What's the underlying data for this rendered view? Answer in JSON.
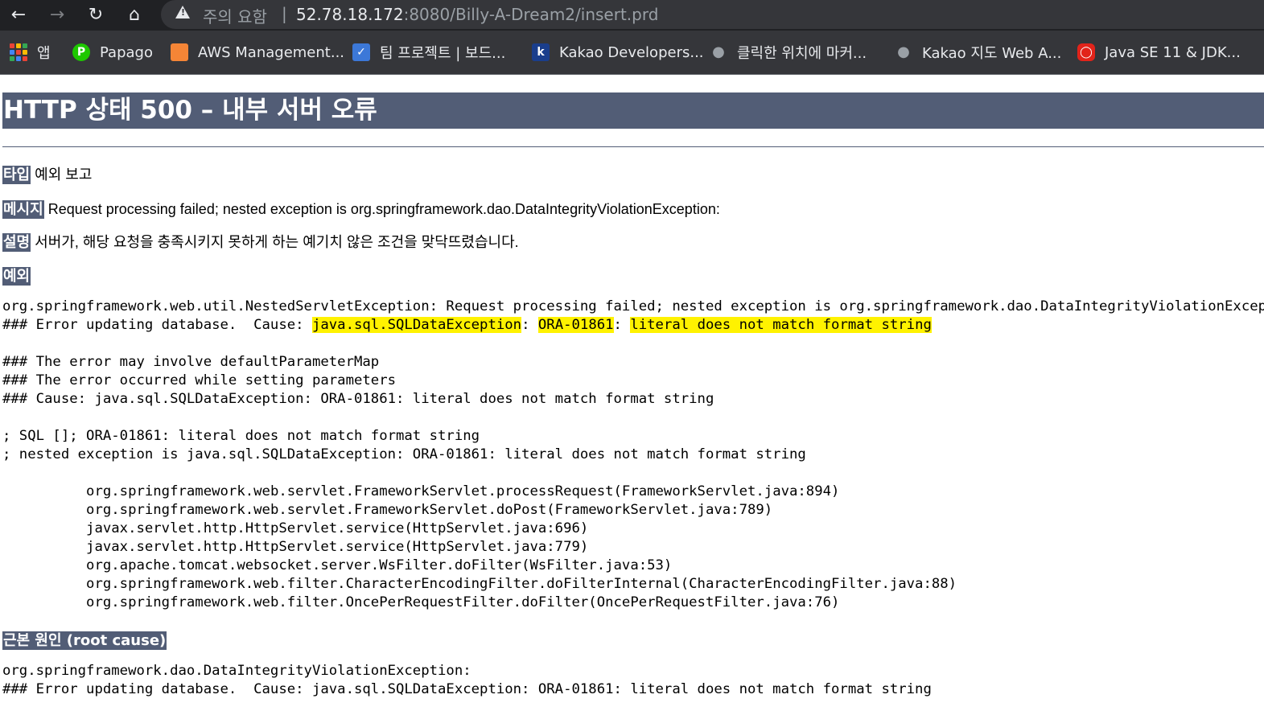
{
  "browser": {
    "security_label": "주의 요함",
    "separator": "|",
    "url_host": "52.78.18.172",
    "url_rest": ":8080/Billy-A-Dream2/insert.prd",
    "bookmarks": [
      {
        "label": "앱"
      },
      {
        "label": "Papago"
      },
      {
        "label": "AWS Management..."
      },
      {
        "label": "팀 프로젝트 | 보드..."
      },
      {
        "label": "Kakao Developers..."
      },
      {
        "label": "클릭한 위치에 마커..."
      },
      {
        "label": "Kakao 지도 Web A..."
      },
      {
        "label": "Java SE 11 & JDK..."
      }
    ]
  },
  "page": {
    "title": "HTTP 상태 500 – 내부 서버 오류",
    "type_label": "타입",
    "type_value": "예외 보고",
    "message_label": "메시지",
    "message_value": "Request processing failed; nested exception is org.springframework.dao.DataIntegrityViolationException:",
    "description_label": "설명",
    "description_value": "서버가, 해당 요청을 충족시키지 못하게 하는 예기치 않은 조건을 맞닥뜨렸습니다.",
    "exception_label": "예외",
    "exception_line1": "org.springframework.web.util.NestedServletException: Request processing failed; nested exception is org.springframework.dao.DataIntegrityViolationException:",
    "exception_line2_prefix": "### Error updating database.  Cause: ",
    "exception_line2_hl1": "java.sql.SQLDataException",
    "exception_line2_sep1": ": ",
    "exception_line2_hl2": "ORA-01861",
    "exception_line2_sep2": ": ",
    "exception_line2_hl3": "literal does not match format string",
    "exception_block": "### The error may involve defaultParameterMap\n### The error occurred while setting parameters\n### Cause: java.sql.SQLDataException: ORA-01861: literal does not match format string\n\n; SQL []; ORA-01861: literal does not match format string\n; nested exception is java.sql.SQLDataException: ORA-01861: literal does not match format string\n\n\torg.springframework.web.servlet.FrameworkServlet.processRequest(FrameworkServlet.java:894)\n\torg.springframework.web.servlet.FrameworkServlet.doPost(FrameworkServlet.java:789)\n\tjavax.servlet.http.HttpServlet.service(HttpServlet.java:696)\n\tjavax.servlet.http.HttpServlet.service(HttpServlet.java:779)\n\torg.apache.tomcat.websocket.server.WsFilter.doFilter(WsFilter.java:53)\n\torg.springframework.web.filter.CharacterEncodingFilter.doFilterInternal(CharacterEncodingFilter.java:88)\n\torg.springframework.web.filter.OncePerRequestFilter.doFilter(OncePerRequestFilter.java:76)",
    "root_cause_label": "근본 원인 (root cause)",
    "root_cause_block": "org.springframework.dao.DataIntegrityViolationException:\n### Error updating database.  Cause: java.sql.SQLDataException: ORA-01861: literal does not match format string"
  },
  "colors": {
    "header_bg": "#525d76",
    "highlight": "#fff200",
    "chrome_bg": "#202124"
  }
}
